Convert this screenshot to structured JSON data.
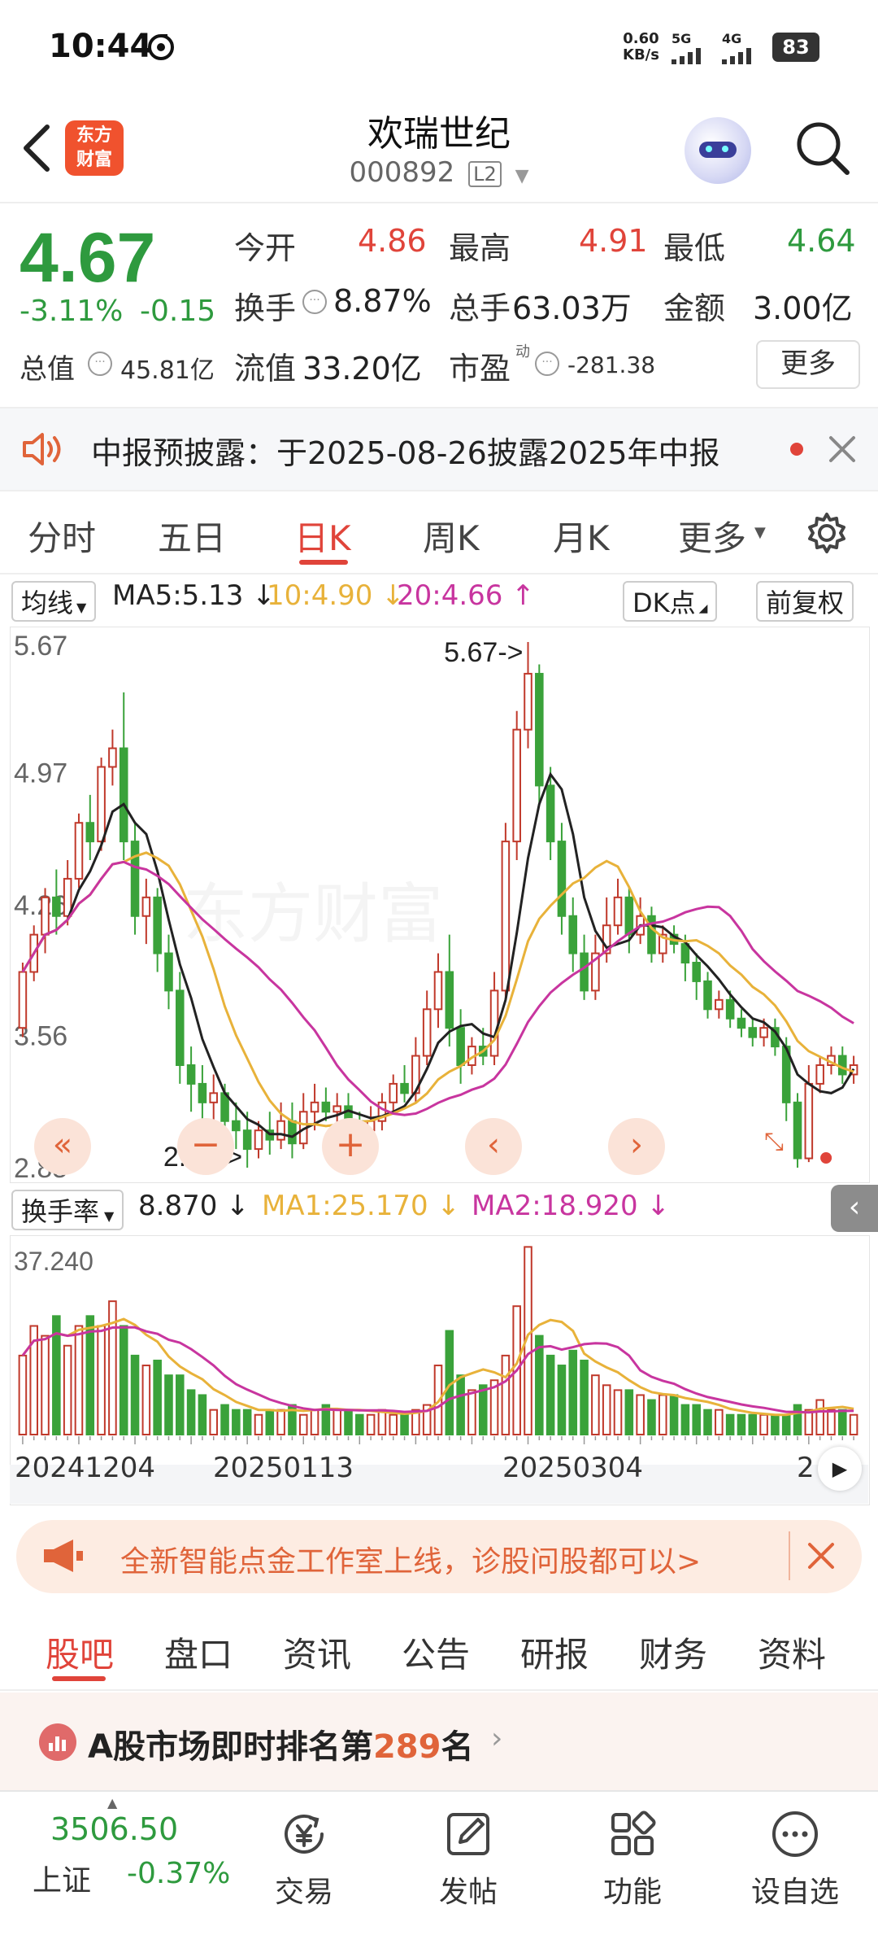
{
  "status_bar": {
    "time": "10:44",
    "net_speed": "0.60",
    "net_unit": "KB/s",
    "sig1": "5G",
    "sig2": "4G",
    "battery": "83"
  },
  "header": {
    "logo_line1": "东方",
    "logo_line2": "财富",
    "stock_name": "欢瑞世纪",
    "stock_code": "000892",
    "level_badge": "L2"
  },
  "quote": {
    "price": "4.67",
    "change_pct": "-3.11%",
    "change": "-0.15",
    "open_label": "今开",
    "open": "4.86",
    "high_label": "最高",
    "high": "4.91",
    "low_label": "最低",
    "low": "4.64",
    "turnover_label": "换手",
    "turnover": "8.87%",
    "volume_label": "总手",
    "volume": "63.03万",
    "amount_label": "金额",
    "amount": "3.00亿",
    "mktcap_label": "总值",
    "mktcap": "45.81亿",
    "float_label": "流值",
    "float": "33.20亿",
    "pe_label": "市盈",
    "pe_sup": "动",
    "pe": "-281.38",
    "more": "更多"
  },
  "notice": {
    "text": "中报预披露：于2025-08-26披露2025年中报"
  },
  "chart_tabs": [
    "分时",
    "五日",
    "日K",
    "周K",
    "月K",
    "更多"
  ],
  "active_tab_index": 2,
  "ma_row": {
    "selector": "均线",
    "ma5": "MA5:5.13",
    "ma10": "10:4.90",
    "ma20": "20:4.66",
    "dk": "DK点",
    "adjust": "前复权"
  },
  "vol_row": {
    "selector": "换手率",
    "value": "8.870",
    "ma1": "MA1:25.170",
    "ma2": "MA2:18.920"
  },
  "colors": {
    "up": "#c0392b",
    "down": "#3aa23a",
    "ma5": "#222222",
    "ma10": "#e8b23a",
    "ma20": "#c8359f",
    "brand": "#f0522e"
  },
  "chart_data": {
    "type": "candlestick",
    "price_axis_labels": [
      "5.67",
      "4.97",
      "4.26",
      "3.56",
      "2.85"
    ],
    "ylim": [
      2.85,
      5.67
    ],
    "max_label": "5.67->",
    "min_label": "2.85->",
    "date_labels": [
      "20241204",
      "20250113",
      "20250304",
      "2"
    ],
    "candles": [
      [
        3.6,
        3.9,
        3.55,
        3.95
      ],
      [
        3.9,
        4.1,
        3.85,
        4.15
      ],
      [
        4.1,
        4.3,
        4.0,
        4.35
      ],
      [
        4.3,
        4.2,
        4.1,
        4.45
      ],
      [
        4.2,
        4.4,
        4.15,
        4.5
      ],
      [
        4.4,
        4.7,
        4.35,
        4.75
      ],
      [
        4.7,
        4.6,
        4.5,
        4.85
      ],
      [
        4.6,
        5.0,
        4.55,
        5.05
      ],
      [
        5.0,
        5.1,
        4.9,
        5.2
      ],
      [
        5.1,
        4.6,
        4.5,
        5.4
      ],
      [
        4.6,
        4.2,
        4.1,
        4.7
      ],
      [
        4.2,
        4.3,
        4.05,
        4.4
      ],
      [
        4.3,
        4.0,
        3.9,
        4.35
      ],
      [
        4.0,
        3.8,
        3.7,
        4.1
      ],
      [
        3.8,
        3.4,
        3.3,
        3.9
      ],
      [
        3.4,
        3.3,
        3.15,
        3.5
      ],
      [
        3.3,
        3.2,
        3.1,
        3.4
      ],
      [
        3.2,
        3.25,
        3.1,
        3.35
      ],
      [
        3.25,
        3.1,
        3.0,
        3.3
      ],
      [
        3.1,
        3.05,
        2.95,
        3.2
      ],
      [
        3.05,
        2.95,
        2.85,
        3.15
      ],
      [
        2.95,
        3.05,
        2.9,
        3.1
      ],
      [
        3.05,
        3.0,
        2.92,
        3.15
      ],
      [
        3.0,
        3.1,
        2.95,
        3.2
      ],
      [
        3.1,
        2.98,
        2.9,
        3.2
      ],
      [
        2.98,
        3.15,
        2.95,
        3.25
      ],
      [
        3.15,
        3.2,
        3.05,
        3.3
      ],
      [
        3.2,
        3.15,
        3.1,
        3.28
      ],
      [
        3.15,
        3.18,
        3.08,
        3.25
      ],
      [
        3.18,
        3.1,
        3.02,
        3.25
      ],
      [
        3.1,
        3.05,
        3.0,
        3.15
      ],
      [
        3.05,
        3.1,
        3.0,
        3.18
      ],
      [
        3.1,
        3.2,
        3.05,
        3.25
      ],
      [
        3.2,
        3.3,
        3.15,
        3.35
      ],
      [
        3.3,
        3.25,
        3.2,
        3.4
      ],
      [
        3.25,
        3.45,
        3.2,
        3.55
      ],
      [
        3.45,
        3.7,
        3.4,
        3.8
      ],
      [
        3.7,
        3.9,
        3.6,
        4.0
      ],
      [
        3.9,
        3.6,
        3.5,
        4.1
      ],
      [
        3.6,
        3.4,
        3.3,
        3.7
      ],
      [
        3.4,
        3.5,
        3.35,
        3.55
      ],
      [
        3.5,
        3.45,
        3.4,
        3.6
      ],
      [
        3.45,
        3.8,
        3.4,
        3.9
      ],
      [
        3.8,
        4.6,
        3.75,
        4.7
      ],
      [
        4.6,
        5.2,
        4.5,
        5.3
      ],
      [
        5.2,
        5.5,
        5.1,
        5.67
      ],
      [
        5.5,
        4.9,
        4.8,
        5.55
      ],
      [
        4.9,
        4.6,
        4.5,
        5.0
      ],
      [
        4.6,
        4.2,
        4.1,
        4.7
      ],
      [
        4.2,
        4.0,
        3.9,
        4.3
      ],
      [
        4.0,
        3.8,
        3.75,
        4.1
      ],
      [
        3.8,
        4.0,
        3.75,
        4.1
      ],
      [
        4.0,
        4.15,
        3.95,
        4.3
      ],
      [
        4.15,
        4.3,
        4.1,
        4.4
      ],
      [
        4.3,
        4.1,
        4.0,
        4.35
      ],
      [
        4.1,
        4.2,
        4.05,
        4.3
      ],
      [
        4.2,
        4.0,
        3.95,
        4.25
      ],
      [
        4.0,
        4.1,
        3.95,
        4.15
      ],
      [
        4.1,
        4.05,
        4.0,
        4.15
      ],
      [
        4.05,
        3.95,
        3.85,
        4.1
      ],
      [
        3.95,
        3.85,
        3.75,
        4.0
      ],
      [
        3.85,
        3.7,
        3.65,
        3.9
      ],
      [
        3.7,
        3.75,
        3.65,
        3.8
      ],
      [
        3.75,
        3.65,
        3.6,
        3.8
      ],
      [
        3.65,
        3.6,
        3.55,
        3.7
      ],
      [
        3.6,
        3.55,
        3.5,
        3.65
      ],
      [
        3.55,
        3.6,
        3.5,
        3.65
      ],
      [
        3.6,
        3.5,
        3.45,
        3.65
      ],
      [
        3.5,
        3.2,
        3.1,
        3.55
      ],
      [
        3.2,
        2.9,
        2.85,
        3.25
      ],
      [
        2.9,
        3.3,
        2.88,
        3.4
      ],
      [
        3.3,
        3.4,
        3.25,
        3.45
      ],
      [
        3.4,
        3.45,
        3.35,
        3.5
      ],
      [
        3.45,
        3.35,
        3.3,
        3.5
      ],
      [
        3.35,
        3.4,
        3.3,
        3.45
      ]
    ],
    "turnover_axis_label": "37.240",
    "turnover": [
      16,
      22,
      20,
      24,
      18,
      22,
      24,
      22,
      27,
      22,
      16,
      14,
      15,
      12,
      12,
      9,
      8,
      5,
      6,
      5,
      5,
      4,
      5,
      5,
      6,
      4,
      5,
      6,
      5,
      5,
      4,
      4,
      5,
      4,
      4,
      5,
      6,
      14,
      21,
      12,
      9,
      10,
      11,
      16,
      26,
      38,
      20,
      16,
      14,
      17,
      15,
      12,
      10,
      9,
      9,
      8,
      7,
      8,
      8,
      6,
      6,
      5,
      5,
      4,
      4,
      4,
      4,
      4,
      4,
      6,
      5,
      7,
      5,
      5,
      4
    ]
  },
  "promo": {
    "text": "全新智能点金工作室上线，诊股问股都可以>"
  },
  "sub_tabs": [
    "股吧",
    "盘口",
    "资讯",
    "公告",
    "研报",
    "财务",
    "资料"
  ],
  "active_sub_tab_index": 0,
  "rank": {
    "prefix": "A股市场即时排名第",
    "number": "289",
    "suffix": "名"
  },
  "bottom_nav": {
    "index_value": "3506.50",
    "index_name": "上证",
    "index_change": "-0.37%",
    "items": [
      "交易",
      "发帖",
      "功能",
      "设自选"
    ]
  }
}
